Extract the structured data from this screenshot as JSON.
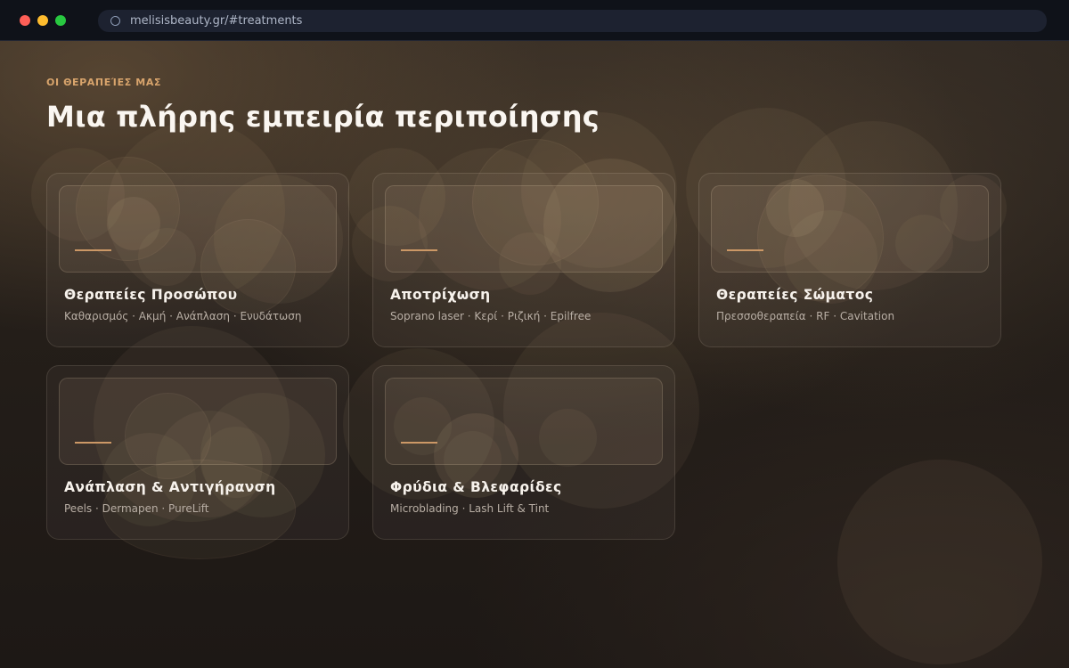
{
  "browser": {
    "url": "melisisbeauty.gr/#treatments",
    "controls": [
      "close",
      "minimize",
      "maximize"
    ]
  },
  "section": {
    "kicker": "ΟΙ ΘΕΡΑΠΕΊΕΣ ΜΑΣ",
    "title": "Μια πλήρης εμπειρία περιποίησης"
  },
  "cards": [
    {
      "title": "Θεραπείες Προσώπου",
      "subtitle": "Καθαρισμός · Ακμή · Ανάπλαση · Ενυδάτωση"
    },
    {
      "title": "Αποτρίχωση",
      "subtitle": "Soprano laser · Κερί · Ριζική · Epilfree"
    },
    {
      "title": "Θεραπείες Σώματος",
      "subtitle": "Πρεσσοθεραπεία · RF · Cavitation"
    },
    {
      "title": "Ανάπλαση & Αντιγήρανση",
      "subtitle": "Peels · Dermapen · PureLift"
    },
    {
      "title": "Φρύδια & Βλεφαρίδες",
      "subtitle": "Microblading · Lash Lift & Tint"
    }
  ],
  "colors": {
    "accent": "#d8a46c",
    "accent_line": "#cc9866",
    "background": "#241e19",
    "chrome": "#0f1219"
  },
  "icons": {
    "url_bar": "globe-icon"
  }
}
